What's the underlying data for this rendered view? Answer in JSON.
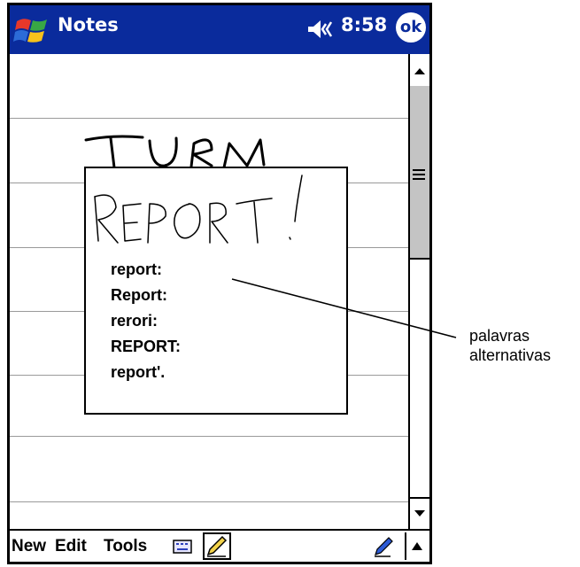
{
  "title_bar": {
    "app_name": "Notes",
    "clock": "8:58",
    "ok_label": "ok",
    "start_icon": "windows-start-flag-icon",
    "volume_icon": "speaker-volume-icon"
  },
  "note": {
    "handwriting": "TURN",
    "ruled_lines": 9
  },
  "recognition_popup": {
    "ink_sample": "REPORT!",
    "alternatives": [
      "report:",
      "Report:",
      "rerori:",
      "REPORT:",
      "report'."
    ]
  },
  "menu_bar": {
    "new_label": "New",
    "edit_label": "Edit",
    "tools_label": "Tools",
    "keyboard_icon": "keyboard-icon",
    "pen_icon": "pen-icon",
    "input_arrow_icon": "arrow-up-icon"
  },
  "callout": {
    "line1": "palavras",
    "line2": "alternativas"
  },
  "colors": {
    "title_bar": "#0a2b9c",
    "scroll_thumb": "#c4c4c4",
    "ruled_line": "#9a9a9a"
  }
}
